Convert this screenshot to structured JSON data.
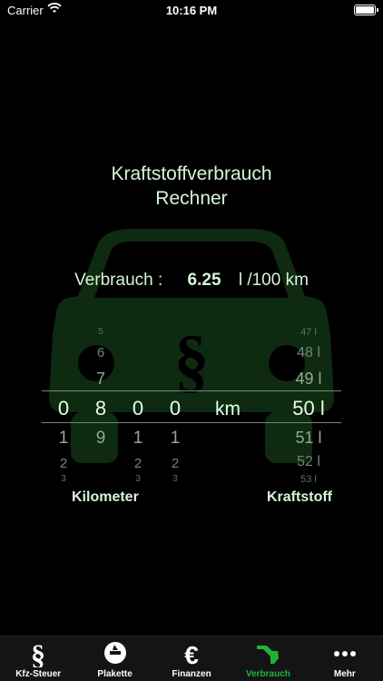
{
  "status_bar": {
    "carrier": "Carrier",
    "time": "10:16 PM"
  },
  "title": {
    "line1": "Kraftstoffverbrauch",
    "line2": "Rechner"
  },
  "consumption": {
    "label": "Verbrauch :",
    "value": "6.25",
    "unit": "l /100 km"
  },
  "picker": {
    "km_digits": [
      {
        "items": [
          "",
          "",
          "0",
          "1",
          "2",
          "3"
        ],
        "selected": "0"
      },
      {
        "items": [
          "5",
          "6",
          "7",
          "8",
          "9",
          ""
        ],
        "selected": "8"
      },
      {
        "items": [
          "",
          "",
          "0",
          "1",
          "2",
          "3"
        ],
        "selected": "0"
      },
      {
        "items": [
          "",
          "",
          "0",
          "1",
          "2",
          "3"
        ],
        "selected": "0"
      }
    ],
    "km_unit": "km",
    "fuel_items": [
      "47 l",
      "48 l",
      "49 l",
      "50 l",
      "51 l",
      "52 l",
      "53 l"
    ],
    "fuel_selected": "50 l"
  },
  "labels": {
    "kilometer": "Kilometer",
    "fuel": "Kraftstoff"
  },
  "tabs": [
    {
      "label": "Kfz-Steuer",
      "icon": "paragraph-icon",
      "active": false
    },
    {
      "label": "Plakette",
      "icon": "sticker-icon",
      "active": false
    },
    {
      "label": "Finanzen",
      "icon": "euro-icon",
      "active": false
    },
    {
      "label": "Verbrauch",
      "icon": "fuel-nozzle-icon",
      "active": true
    },
    {
      "label": "Mehr",
      "icon": "more-dots-icon",
      "active": false
    }
  ],
  "colors": {
    "background": "#000000",
    "text": "#d6f5d6",
    "accent": "#1fb23a",
    "car": "#0f2a12"
  }
}
